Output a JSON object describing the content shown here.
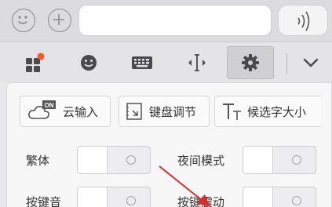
{
  "top_bar": {
    "icons": [
      "smiley-face-icon",
      "plus-icon",
      "voice-icon"
    ],
    "text_field_value": ""
  },
  "toolbar": {
    "icons": [
      "apps-grid-icon",
      "emoji-icon",
      "keyboard-icon",
      "cursor-move-icon",
      "settings-gear-icon",
      "collapse-chevron-icon"
    ],
    "active": "settings-gear-icon",
    "badge_color": "#f5572b"
  },
  "settings": {
    "options": {
      "cloud_input": "云输入",
      "cloud_badge": "ON",
      "keyboard_adjust": "键盘调节",
      "candidate_size": "候选字大小"
    },
    "toggles": {
      "traditional": "繁体",
      "night_mode": "夜间模式",
      "key_sound": "按键音",
      "key_vibration": "按键震动"
    }
  },
  "colors": {
    "arrow": "#d42f2f",
    "accent": "#555555"
  }
}
